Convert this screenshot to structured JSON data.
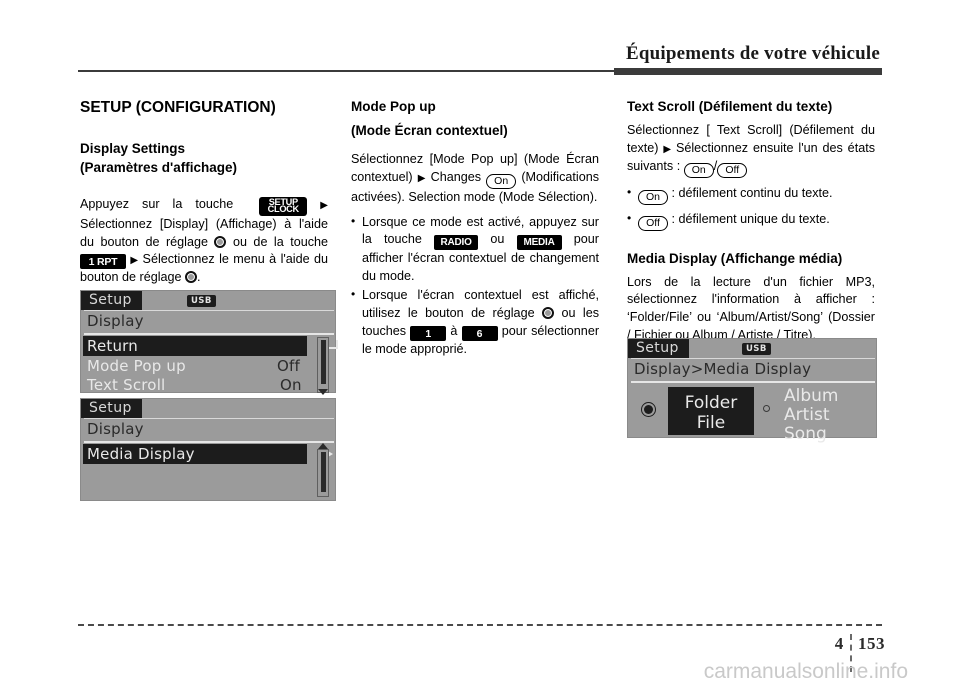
{
  "header": {
    "title": "Équipements de votre véhicule"
  },
  "footer": {
    "chapter": "4",
    "page": "153",
    "watermark": "carmanualsonline.info"
  },
  "col1": {
    "section_title": "SETUP (CONFIGURATION)",
    "subsection_title_en": "Display Settings",
    "subsection_title_fr": "(Paramètres d'affichage)",
    "paragraph": {
      "p1": "Appuyez sur la touche",
      "key_setup": "SETUP",
      "key_clock": "CLOCK",
      "arrow1": "▶",
      "p2": "Sélectionnez [Display] (Affichage) à l'aide du bouton de réglage",
      "knob1": "jog-dial",
      "p3": "ou de la touche",
      "key_1rpt": "1 RPT",
      "arrow2": "▶",
      "p4": "Sélectionnez le menu à l'aide du bouton de réglage",
      "knob2": "jog-dial",
      "p5": "."
    },
    "lcd1": {
      "tab": "Setup",
      "usb": "USB",
      "breadcrumb": "Display",
      "rows": [
        {
          "label": "Return",
          "value": "",
          "selected": true,
          "button_icon": "return-arrow"
        },
        {
          "label": "Mode Pop up",
          "value": "Off",
          "selected": false
        },
        {
          "label": "Text Scroll",
          "value": "On",
          "selected": false
        }
      ]
    },
    "lcd2": {
      "tab": "Setup",
      "usb": "",
      "breadcrumb": "Display",
      "rows": [
        {
          "label": "Media Display",
          "value": "",
          "selected": true,
          "button_icon": "right-arrow"
        }
      ]
    }
  },
  "col2": {
    "heading_en": "Mode Pop up",
    "heading_fr": "(Mode Écran contextuel)",
    "paragraph": {
      "p1": "Sélectionnez [Mode Pop up] (Mode Écran contextuel)",
      "arrow1": "▶",
      "p2": "Changes",
      "pill_on": "On",
      "p3": "(Modifications activées). Selection mode (Mode Sélection)."
    },
    "bullets": [
      {
        "t1": "Lorsque ce mode est activé, appuyez sur la touche",
        "key_radio": "RADIO",
        "t2": "ou",
        "key_media": "MEDIA",
        "t3": "pour afficher l'écran contextuel de changement du mode."
      },
      {
        "t1": "Lorsque l'écran contextuel est affiché, utilisez le bouton de réglage",
        "knob": "jog-dial",
        "t2": "ou les touches",
        "key_1": "1",
        "t3": "à",
        "key_6": "6",
        "t4": "pour sélectionner le mode approprié."
      }
    ]
  },
  "col3": {
    "heading1": "Text Scroll (Défilement du texte)",
    "paragraph1": {
      "p1": "Sélectionnez [ Text Scroll] (Défilement du texte)",
      "arrow1": "▶",
      "p2": "Sélectionnez ensuite l'un des états suivants :",
      "pill_on": "On",
      "sep": "/",
      "pill_off": "Off"
    },
    "bullets": [
      {
        "pill": "On",
        "text": ": défilement continu du texte."
      },
      {
        "pill": "Off",
        "text": ": défilement unique du texte."
      }
    ],
    "heading2": "Media Display (Affichange média)",
    "paragraph2": "Lors de la lecture d'un fichier MP3, sélectionnez l'information à afficher : ‘Folder/File’ ou ‘Album/Artist/Song’ (Dossier / Fichier ou Album / Artiste / Titre).",
    "lcd3": {
      "tab": "Setup",
      "usb": "USB",
      "breadcrumb": "Display>Media Display",
      "option_selected": {
        "line1": "Folder",
        "line2": "File"
      },
      "option_other": {
        "line1": "Album",
        "line2": "Artist",
        "line3": "Song"
      }
    }
  },
  "colors": {
    "lcd_background": "#9b9b9b",
    "lcd_dark": "#1c1c1c",
    "rule": "#3b3b3b",
    "watermark": "#c9c9c9"
  }
}
